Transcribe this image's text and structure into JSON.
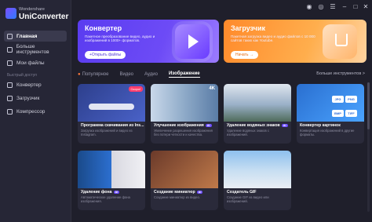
{
  "app": {
    "brand_sub": "Wondershare",
    "brand_main": "UniConverter"
  },
  "sidebar": {
    "items": [
      {
        "label": "Главная",
        "icon": "home-icon"
      },
      {
        "label": "Больше инструментов",
        "icon": "tools-icon"
      },
      {
        "label": "Мои файлы",
        "icon": "folder-icon"
      }
    ],
    "section_label": "Быстрый доступ",
    "quick": [
      {
        "label": "Конвертер",
        "icon": "convert-icon"
      },
      {
        "label": "Загрузчик",
        "icon": "download-icon"
      },
      {
        "label": "Компрессор",
        "icon": "compress-icon"
      }
    ]
  },
  "titlebar": {
    "icons": [
      "user-icon",
      "headset-icon",
      "menu-icon",
      "minimize-icon",
      "maximize-icon",
      "close-icon"
    ],
    "glyphs": [
      "◉",
      "◎",
      "☰",
      "–",
      "□",
      "✕"
    ]
  },
  "banners": {
    "converter": {
      "title": "Конвертер",
      "desc": "Пакетное преобразование видео, аудио и изображений в 1000+ форматов.",
      "button": "+Открыть файлы"
    },
    "downloader": {
      "title": "Загрузчик",
      "desc": "Пакетная загрузка видео и аудио файлов с 10 000 сайтов таких как Youtube.",
      "button": "Начать →"
    }
  },
  "tabs": {
    "items": [
      "Популярное",
      "Видео",
      "Аудио",
      "Изображение"
    ],
    "active_index": 3,
    "more_tools": "Больше инструментов >"
  },
  "cards": [
    {
      "title": "Программа скачивания из Ins...",
      "desc": "Загрузка изображений и видео из Instagram.",
      "badge": "",
      "new": "Скоро!"
    },
    {
      "title": "Улучшение изображения",
      "desc": "Увеличение разрешения изображения без потери четкости и качества.",
      "badge": "AI",
      "new": "",
      "label": "4K"
    },
    {
      "title": "Удаление водяных знаков",
      "desc": "Удаление водяных знаков с изображений.",
      "badge": "AI",
      "new": ""
    },
    {
      "title": "Конвертер картинок",
      "desc": "Конвертация изображений в другие форматы.",
      "badge": "",
      "new": "",
      "chips": [
        "JPG",
        "PNG",
        "BMP",
        "TIFF"
      ]
    },
    {
      "title": "Удаление фона",
      "desc": "Автоматическое удаление фона изображения.",
      "badge": "AI",
      "new": ""
    },
    {
      "title": "Создание миниатюр",
      "desc": "Создание миниатюр из видео.",
      "badge": "AI",
      "new": ""
    },
    {
      "title": "Создатель GIF",
      "desc": "Создание GIF из видео или изображений.",
      "badge": "",
      "new": ""
    }
  ],
  "colors": {
    "accent": "#6a4bff",
    "converter_banner": "#5a3cf0",
    "downloader_banner": "#ff8a2b"
  }
}
